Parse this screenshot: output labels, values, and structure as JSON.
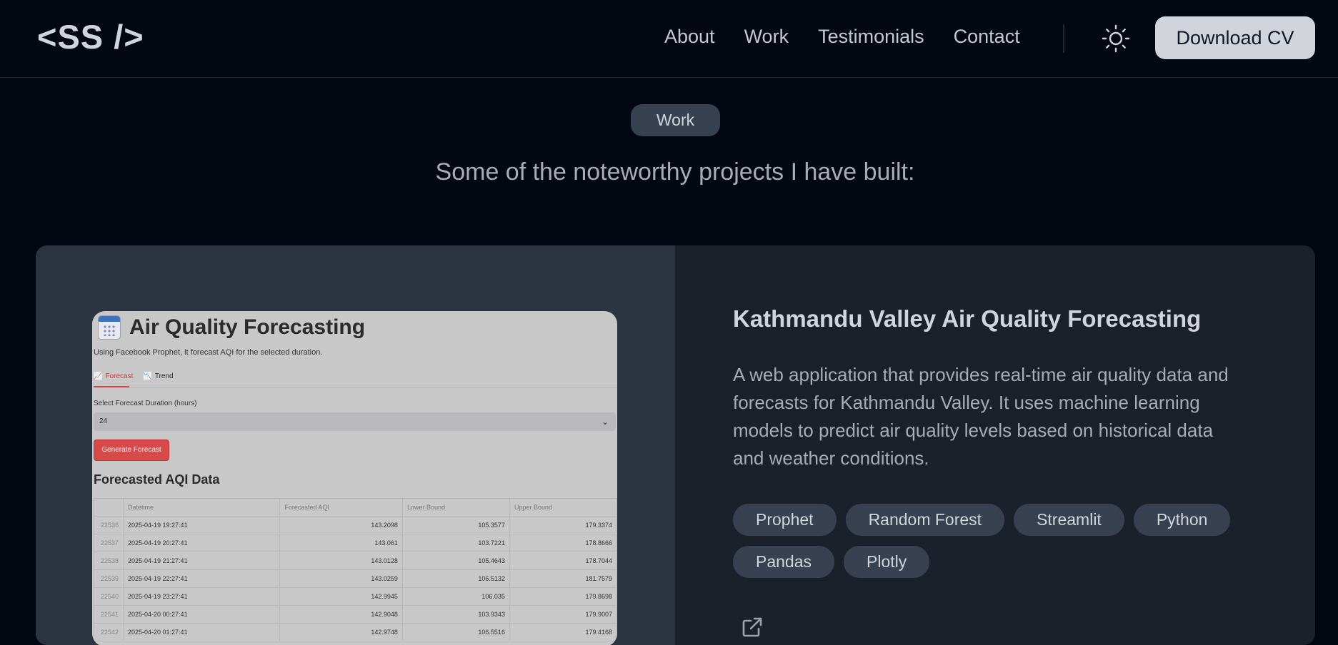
{
  "header": {
    "logo": "<SS />",
    "nav": [
      "About",
      "Work",
      "Testimonials",
      "Contact"
    ],
    "theme_icon": "sun-icon",
    "download_label": "Download CV"
  },
  "section": {
    "badge": "Work",
    "subtitle": "Some of the noteworthy projects I have built:"
  },
  "project": {
    "title": "Kathmandu Valley Air Quality Forecasting",
    "description": "A web application that provides real-time air quality data and forecasts for Kathmandu Valley. It uses machine learning models to predict air quality levels based on historical data and weather conditions.",
    "tags": [
      "Prophet",
      "Random Forest",
      "Streamlit",
      "Python",
      "Pandas",
      "Plotly"
    ],
    "link_icon": "external-link-icon",
    "preview": {
      "title": "Air Quality Forecasting",
      "description": "Using Facebook Prophet, it forecast AQI for the selected duration.",
      "tabs": [
        "Forecast",
        "Trend"
      ],
      "select_label": "Select Forecast Duration (hours)",
      "select_value": "24",
      "button_label": "Generate Forecast",
      "table_title": "Forecasted AQI Data",
      "table_headers": [
        "",
        "Datetime",
        "Forecasted AQI",
        "Lower Bound",
        "Upper Bound"
      ],
      "table_rows": [
        [
          "22536",
          "2025-04-19 19:27:41",
          "143.2098",
          "105.3577",
          "179.3374"
        ],
        [
          "22537",
          "2025-04-19 20:27:41",
          "143.061",
          "103.7221",
          "178.8666"
        ],
        [
          "22538",
          "2025-04-19 21:27:41",
          "143.0128",
          "105.4643",
          "178.7044"
        ],
        [
          "22539",
          "2025-04-19 22:27:41",
          "143.0259",
          "106.5132",
          "181.7579"
        ],
        [
          "22540",
          "2025-04-19 23:27:41",
          "142.9945",
          "106.035",
          "179.8698"
        ],
        [
          "22541",
          "2025-04-20 00:27:41",
          "142.9048",
          "103.9343",
          "179.9007"
        ],
        [
          "22542",
          "2025-04-20 01:27:41",
          "142.9748",
          "106.5516",
          "179.4168"
        ]
      ]
    }
  },
  "colors": {
    "background": "#030712",
    "card_left": "#2c3441",
    "card_right": "#1b202b",
    "tag_bg": "#374151",
    "button_bg": "#d1d5db"
  }
}
